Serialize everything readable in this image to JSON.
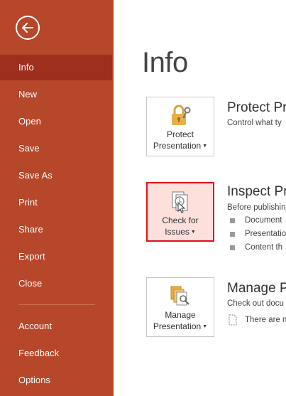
{
  "sidebar": {
    "back_icon": "back-arrow-icon",
    "items": [
      {
        "label": "Info",
        "selected": true
      },
      {
        "label": "New"
      },
      {
        "label": "Open"
      },
      {
        "label": "Save"
      },
      {
        "label": "Save As"
      },
      {
        "label": "Print"
      },
      {
        "label": "Share"
      },
      {
        "label": "Export"
      },
      {
        "label": "Close"
      },
      {
        "label": "Account"
      },
      {
        "label": "Feedback"
      },
      {
        "label": "Options"
      }
    ]
  },
  "main": {
    "title": "Info",
    "sections": [
      {
        "button_line1": "Protect",
        "button_line2": "Presentation",
        "heading": "Protect Pre",
        "description": "Control what ty"
      },
      {
        "button_line1": "Check for",
        "button_line2": "Issues",
        "heading": "Inspect Pre",
        "description": "Before publishin",
        "bullets": [
          "Document",
          "Presentatio",
          "Content th"
        ]
      },
      {
        "button_line1": "Manage",
        "button_line2": "Presentation",
        "heading": "Manage P",
        "description": "Check out docu",
        "note": "There are n"
      }
    ]
  },
  "colors": {
    "sidebar": "#b7472a",
    "sidebar_selected": "#9e2e1e",
    "highlight_border": "#e3101a",
    "highlight_fill": "#fde0dc"
  }
}
